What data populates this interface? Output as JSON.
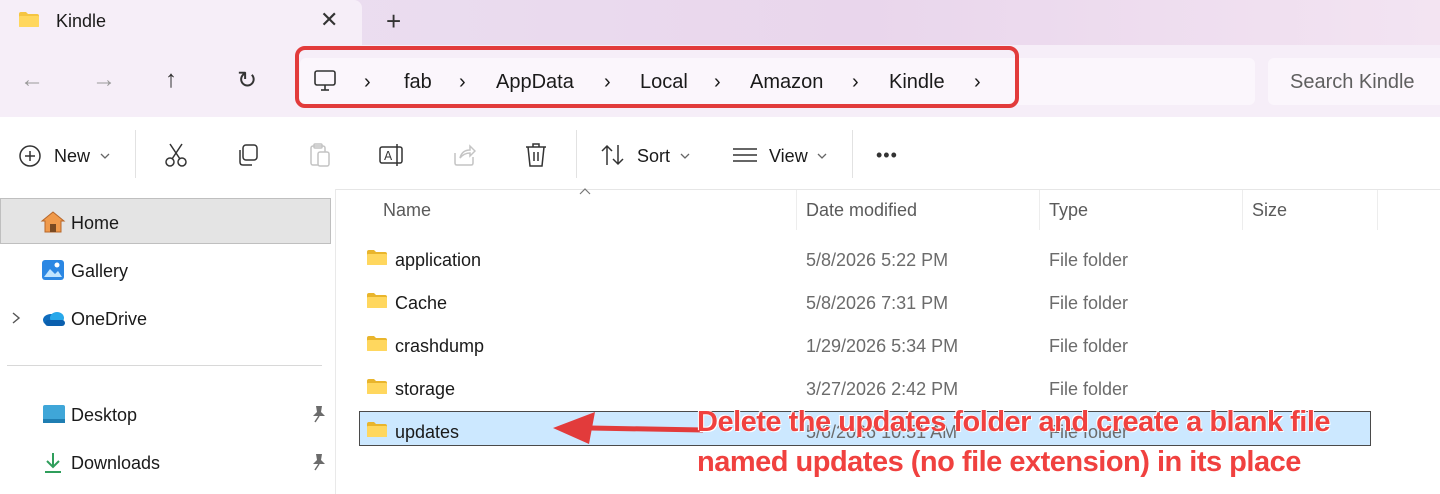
{
  "window": {
    "tab_title": "Kindle",
    "close_glyph": "✕",
    "new_tab_glyph": "+"
  },
  "nav": {
    "back_glyph": "←",
    "forward_glyph": "→",
    "up_glyph": "↑",
    "refresh_glyph": "↻",
    "breadcrumb": [
      "fab",
      "AppData",
      "Local",
      "Amazon",
      "Kindle"
    ],
    "separator": "›",
    "search_placeholder": "Search Kindle"
  },
  "toolbar": {
    "new_label": "New",
    "sort_label": "Sort",
    "view_label": "View",
    "more_glyph": "•••"
  },
  "sidebar": {
    "items": [
      {
        "label": "Home",
        "icon": "home-icon",
        "selected": true
      },
      {
        "label": "Gallery",
        "icon": "gallery-icon"
      },
      {
        "label": "OneDrive",
        "icon": "onedrive-icon"
      },
      {
        "label": "Desktop",
        "icon": "desktop-icon",
        "pinned": true
      },
      {
        "label": "Downloads",
        "icon": "downloads-icon",
        "pinned": true
      }
    ]
  },
  "list": {
    "columns": [
      "Name",
      "Date modified",
      "Type",
      "Size"
    ],
    "rows": [
      {
        "name": "application",
        "date": "5/8/2026 5:22 PM",
        "type": "File folder"
      },
      {
        "name": "Cache",
        "date": "5/8/2026 7:31 PM",
        "type": "File folder"
      },
      {
        "name": "crashdump",
        "date": "1/29/2026 5:34 PM",
        "type": "File folder"
      },
      {
        "name": "storage",
        "date": "3/27/2026 2:42 PM",
        "type": "File folder"
      },
      {
        "name": "updates",
        "date": "5/6/2026 10:51 AM",
        "type": "File folder",
        "selected": true
      }
    ]
  },
  "annotation": {
    "line1": "Delete the updates folder and create a blank file",
    "line2": "named updates (no file extension) in its place",
    "color": "#f0413f"
  },
  "colors": {
    "accent_red": "#e23b3b",
    "selection": "#cce8ff",
    "folder": "#f5c542"
  }
}
